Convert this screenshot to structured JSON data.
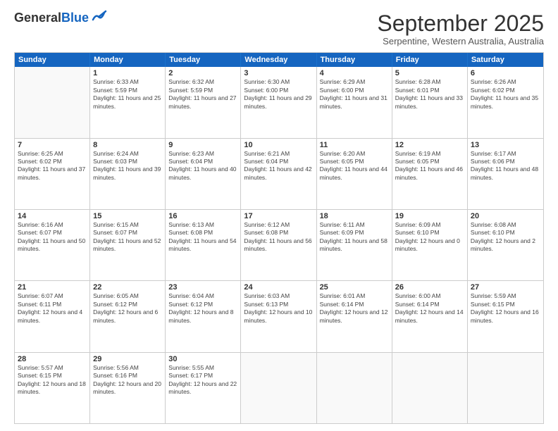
{
  "header": {
    "logo_general": "General",
    "logo_blue": "Blue",
    "month_title": "September 2025",
    "subtitle": "Serpentine, Western Australia, Australia"
  },
  "days_of_week": [
    "Sunday",
    "Monday",
    "Tuesday",
    "Wednesday",
    "Thursday",
    "Friday",
    "Saturday"
  ],
  "weeks": [
    [
      {
        "day": "",
        "empty": true
      },
      {
        "day": "1",
        "sunrise": "Sunrise: 6:33 AM",
        "sunset": "Sunset: 5:59 PM",
        "daylight": "Daylight: 11 hours and 25 minutes."
      },
      {
        "day": "2",
        "sunrise": "Sunrise: 6:32 AM",
        "sunset": "Sunset: 5:59 PM",
        "daylight": "Daylight: 11 hours and 27 minutes."
      },
      {
        "day": "3",
        "sunrise": "Sunrise: 6:30 AM",
        "sunset": "Sunset: 6:00 PM",
        "daylight": "Daylight: 11 hours and 29 minutes."
      },
      {
        "day": "4",
        "sunrise": "Sunrise: 6:29 AM",
        "sunset": "Sunset: 6:00 PM",
        "daylight": "Daylight: 11 hours and 31 minutes."
      },
      {
        "day": "5",
        "sunrise": "Sunrise: 6:28 AM",
        "sunset": "Sunset: 6:01 PM",
        "daylight": "Daylight: 11 hours and 33 minutes."
      },
      {
        "day": "6",
        "sunrise": "Sunrise: 6:26 AM",
        "sunset": "Sunset: 6:02 PM",
        "daylight": "Daylight: 11 hours and 35 minutes."
      }
    ],
    [
      {
        "day": "7",
        "sunrise": "Sunrise: 6:25 AM",
        "sunset": "Sunset: 6:02 PM",
        "daylight": "Daylight: 11 hours and 37 minutes."
      },
      {
        "day": "8",
        "sunrise": "Sunrise: 6:24 AM",
        "sunset": "Sunset: 6:03 PM",
        "daylight": "Daylight: 11 hours and 39 minutes."
      },
      {
        "day": "9",
        "sunrise": "Sunrise: 6:23 AM",
        "sunset": "Sunset: 6:04 PM",
        "daylight": "Daylight: 11 hours and 40 minutes."
      },
      {
        "day": "10",
        "sunrise": "Sunrise: 6:21 AM",
        "sunset": "Sunset: 6:04 PM",
        "daylight": "Daylight: 11 hours and 42 minutes."
      },
      {
        "day": "11",
        "sunrise": "Sunrise: 6:20 AM",
        "sunset": "Sunset: 6:05 PM",
        "daylight": "Daylight: 11 hours and 44 minutes."
      },
      {
        "day": "12",
        "sunrise": "Sunrise: 6:19 AM",
        "sunset": "Sunset: 6:05 PM",
        "daylight": "Daylight: 11 hours and 46 minutes."
      },
      {
        "day": "13",
        "sunrise": "Sunrise: 6:17 AM",
        "sunset": "Sunset: 6:06 PM",
        "daylight": "Daylight: 11 hours and 48 minutes."
      }
    ],
    [
      {
        "day": "14",
        "sunrise": "Sunrise: 6:16 AM",
        "sunset": "Sunset: 6:07 PM",
        "daylight": "Daylight: 11 hours and 50 minutes."
      },
      {
        "day": "15",
        "sunrise": "Sunrise: 6:15 AM",
        "sunset": "Sunset: 6:07 PM",
        "daylight": "Daylight: 11 hours and 52 minutes."
      },
      {
        "day": "16",
        "sunrise": "Sunrise: 6:13 AM",
        "sunset": "Sunset: 6:08 PM",
        "daylight": "Daylight: 11 hours and 54 minutes."
      },
      {
        "day": "17",
        "sunrise": "Sunrise: 6:12 AM",
        "sunset": "Sunset: 6:08 PM",
        "daylight": "Daylight: 11 hours and 56 minutes."
      },
      {
        "day": "18",
        "sunrise": "Sunrise: 6:11 AM",
        "sunset": "Sunset: 6:09 PM",
        "daylight": "Daylight: 11 hours and 58 minutes."
      },
      {
        "day": "19",
        "sunrise": "Sunrise: 6:09 AM",
        "sunset": "Sunset: 6:10 PM",
        "daylight": "Daylight: 12 hours and 0 minutes."
      },
      {
        "day": "20",
        "sunrise": "Sunrise: 6:08 AM",
        "sunset": "Sunset: 6:10 PM",
        "daylight": "Daylight: 12 hours and 2 minutes."
      }
    ],
    [
      {
        "day": "21",
        "sunrise": "Sunrise: 6:07 AM",
        "sunset": "Sunset: 6:11 PM",
        "daylight": "Daylight: 12 hours and 4 minutes."
      },
      {
        "day": "22",
        "sunrise": "Sunrise: 6:05 AM",
        "sunset": "Sunset: 6:12 PM",
        "daylight": "Daylight: 12 hours and 6 minutes."
      },
      {
        "day": "23",
        "sunrise": "Sunrise: 6:04 AM",
        "sunset": "Sunset: 6:12 PM",
        "daylight": "Daylight: 12 hours and 8 minutes."
      },
      {
        "day": "24",
        "sunrise": "Sunrise: 6:03 AM",
        "sunset": "Sunset: 6:13 PM",
        "daylight": "Daylight: 12 hours and 10 minutes."
      },
      {
        "day": "25",
        "sunrise": "Sunrise: 6:01 AM",
        "sunset": "Sunset: 6:14 PM",
        "daylight": "Daylight: 12 hours and 12 minutes."
      },
      {
        "day": "26",
        "sunrise": "Sunrise: 6:00 AM",
        "sunset": "Sunset: 6:14 PM",
        "daylight": "Daylight: 12 hours and 14 minutes."
      },
      {
        "day": "27",
        "sunrise": "Sunrise: 5:59 AM",
        "sunset": "Sunset: 6:15 PM",
        "daylight": "Daylight: 12 hours and 16 minutes."
      }
    ],
    [
      {
        "day": "28",
        "sunrise": "Sunrise: 5:57 AM",
        "sunset": "Sunset: 6:15 PM",
        "daylight": "Daylight: 12 hours and 18 minutes."
      },
      {
        "day": "29",
        "sunrise": "Sunrise: 5:56 AM",
        "sunset": "Sunset: 6:16 PM",
        "daylight": "Daylight: 12 hours and 20 minutes."
      },
      {
        "day": "30",
        "sunrise": "Sunrise: 5:55 AM",
        "sunset": "Sunset: 6:17 PM",
        "daylight": "Daylight: 12 hours and 22 minutes."
      },
      {
        "day": "",
        "empty": true
      },
      {
        "day": "",
        "empty": true
      },
      {
        "day": "",
        "empty": true
      },
      {
        "day": "",
        "empty": true
      }
    ]
  ]
}
